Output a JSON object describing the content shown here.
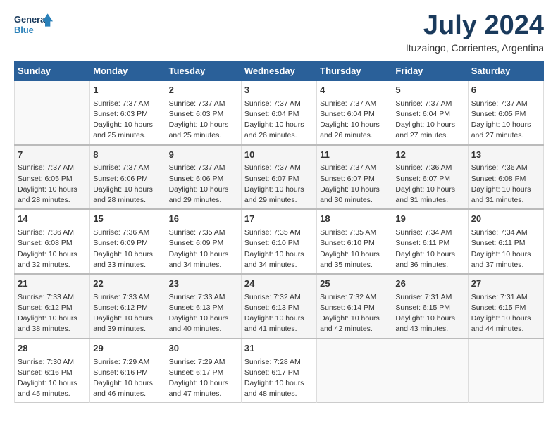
{
  "header": {
    "logo_line1": "General",
    "logo_line2": "Blue",
    "month": "July 2024",
    "location": "Ituzaingo, Corrientes, Argentina"
  },
  "days_of_week": [
    "Sunday",
    "Monday",
    "Tuesday",
    "Wednesday",
    "Thursday",
    "Friday",
    "Saturday"
  ],
  "weeks": [
    [
      {
        "day": "",
        "info": ""
      },
      {
        "day": "1",
        "info": "Sunrise: 7:37 AM\nSunset: 6:03 PM\nDaylight: 10 hours\nand 25 minutes."
      },
      {
        "day": "2",
        "info": "Sunrise: 7:37 AM\nSunset: 6:03 PM\nDaylight: 10 hours\nand 25 minutes."
      },
      {
        "day": "3",
        "info": "Sunrise: 7:37 AM\nSunset: 6:04 PM\nDaylight: 10 hours\nand 26 minutes."
      },
      {
        "day": "4",
        "info": "Sunrise: 7:37 AM\nSunset: 6:04 PM\nDaylight: 10 hours\nand 26 minutes."
      },
      {
        "day": "5",
        "info": "Sunrise: 7:37 AM\nSunset: 6:04 PM\nDaylight: 10 hours\nand 27 minutes."
      },
      {
        "day": "6",
        "info": "Sunrise: 7:37 AM\nSunset: 6:05 PM\nDaylight: 10 hours\nand 27 minutes."
      }
    ],
    [
      {
        "day": "7",
        "info": "Sunrise: 7:37 AM\nSunset: 6:05 PM\nDaylight: 10 hours\nand 28 minutes."
      },
      {
        "day": "8",
        "info": "Sunrise: 7:37 AM\nSunset: 6:06 PM\nDaylight: 10 hours\nand 28 minutes."
      },
      {
        "day": "9",
        "info": "Sunrise: 7:37 AM\nSunset: 6:06 PM\nDaylight: 10 hours\nand 29 minutes."
      },
      {
        "day": "10",
        "info": "Sunrise: 7:37 AM\nSunset: 6:07 PM\nDaylight: 10 hours\nand 29 minutes."
      },
      {
        "day": "11",
        "info": "Sunrise: 7:37 AM\nSunset: 6:07 PM\nDaylight: 10 hours\nand 30 minutes."
      },
      {
        "day": "12",
        "info": "Sunrise: 7:36 AM\nSunset: 6:07 PM\nDaylight: 10 hours\nand 31 minutes."
      },
      {
        "day": "13",
        "info": "Sunrise: 7:36 AM\nSunset: 6:08 PM\nDaylight: 10 hours\nand 31 minutes."
      }
    ],
    [
      {
        "day": "14",
        "info": "Sunrise: 7:36 AM\nSunset: 6:08 PM\nDaylight: 10 hours\nand 32 minutes."
      },
      {
        "day": "15",
        "info": "Sunrise: 7:36 AM\nSunset: 6:09 PM\nDaylight: 10 hours\nand 33 minutes."
      },
      {
        "day": "16",
        "info": "Sunrise: 7:35 AM\nSunset: 6:09 PM\nDaylight: 10 hours\nand 34 minutes."
      },
      {
        "day": "17",
        "info": "Sunrise: 7:35 AM\nSunset: 6:10 PM\nDaylight: 10 hours\nand 34 minutes."
      },
      {
        "day": "18",
        "info": "Sunrise: 7:35 AM\nSunset: 6:10 PM\nDaylight: 10 hours\nand 35 minutes."
      },
      {
        "day": "19",
        "info": "Sunrise: 7:34 AM\nSunset: 6:11 PM\nDaylight: 10 hours\nand 36 minutes."
      },
      {
        "day": "20",
        "info": "Sunrise: 7:34 AM\nSunset: 6:11 PM\nDaylight: 10 hours\nand 37 minutes."
      }
    ],
    [
      {
        "day": "21",
        "info": "Sunrise: 7:33 AM\nSunset: 6:12 PM\nDaylight: 10 hours\nand 38 minutes."
      },
      {
        "day": "22",
        "info": "Sunrise: 7:33 AM\nSunset: 6:12 PM\nDaylight: 10 hours\nand 39 minutes."
      },
      {
        "day": "23",
        "info": "Sunrise: 7:33 AM\nSunset: 6:13 PM\nDaylight: 10 hours\nand 40 minutes."
      },
      {
        "day": "24",
        "info": "Sunrise: 7:32 AM\nSunset: 6:13 PM\nDaylight: 10 hours\nand 41 minutes."
      },
      {
        "day": "25",
        "info": "Sunrise: 7:32 AM\nSunset: 6:14 PM\nDaylight: 10 hours\nand 42 minutes."
      },
      {
        "day": "26",
        "info": "Sunrise: 7:31 AM\nSunset: 6:15 PM\nDaylight: 10 hours\nand 43 minutes."
      },
      {
        "day": "27",
        "info": "Sunrise: 7:31 AM\nSunset: 6:15 PM\nDaylight: 10 hours\nand 44 minutes."
      }
    ],
    [
      {
        "day": "28",
        "info": "Sunrise: 7:30 AM\nSunset: 6:16 PM\nDaylight: 10 hours\nand 45 minutes."
      },
      {
        "day": "29",
        "info": "Sunrise: 7:29 AM\nSunset: 6:16 PM\nDaylight: 10 hours\nand 46 minutes."
      },
      {
        "day": "30",
        "info": "Sunrise: 7:29 AM\nSunset: 6:17 PM\nDaylight: 10 hours\nand 47 minutes."
      },
      {
        "day": "31",
        "info": "Sunrise: 7:28 AM\nSunset: 6:17 PM\nDaylight: 10 hours\nand 48 minutes."
      },
      {
        "day": "",
        "info": ""
      },
      {
        "day": "",
        "info": ""
      },
      {
        "day": "",
        "info": ""
      }
    ]
  ]
}
